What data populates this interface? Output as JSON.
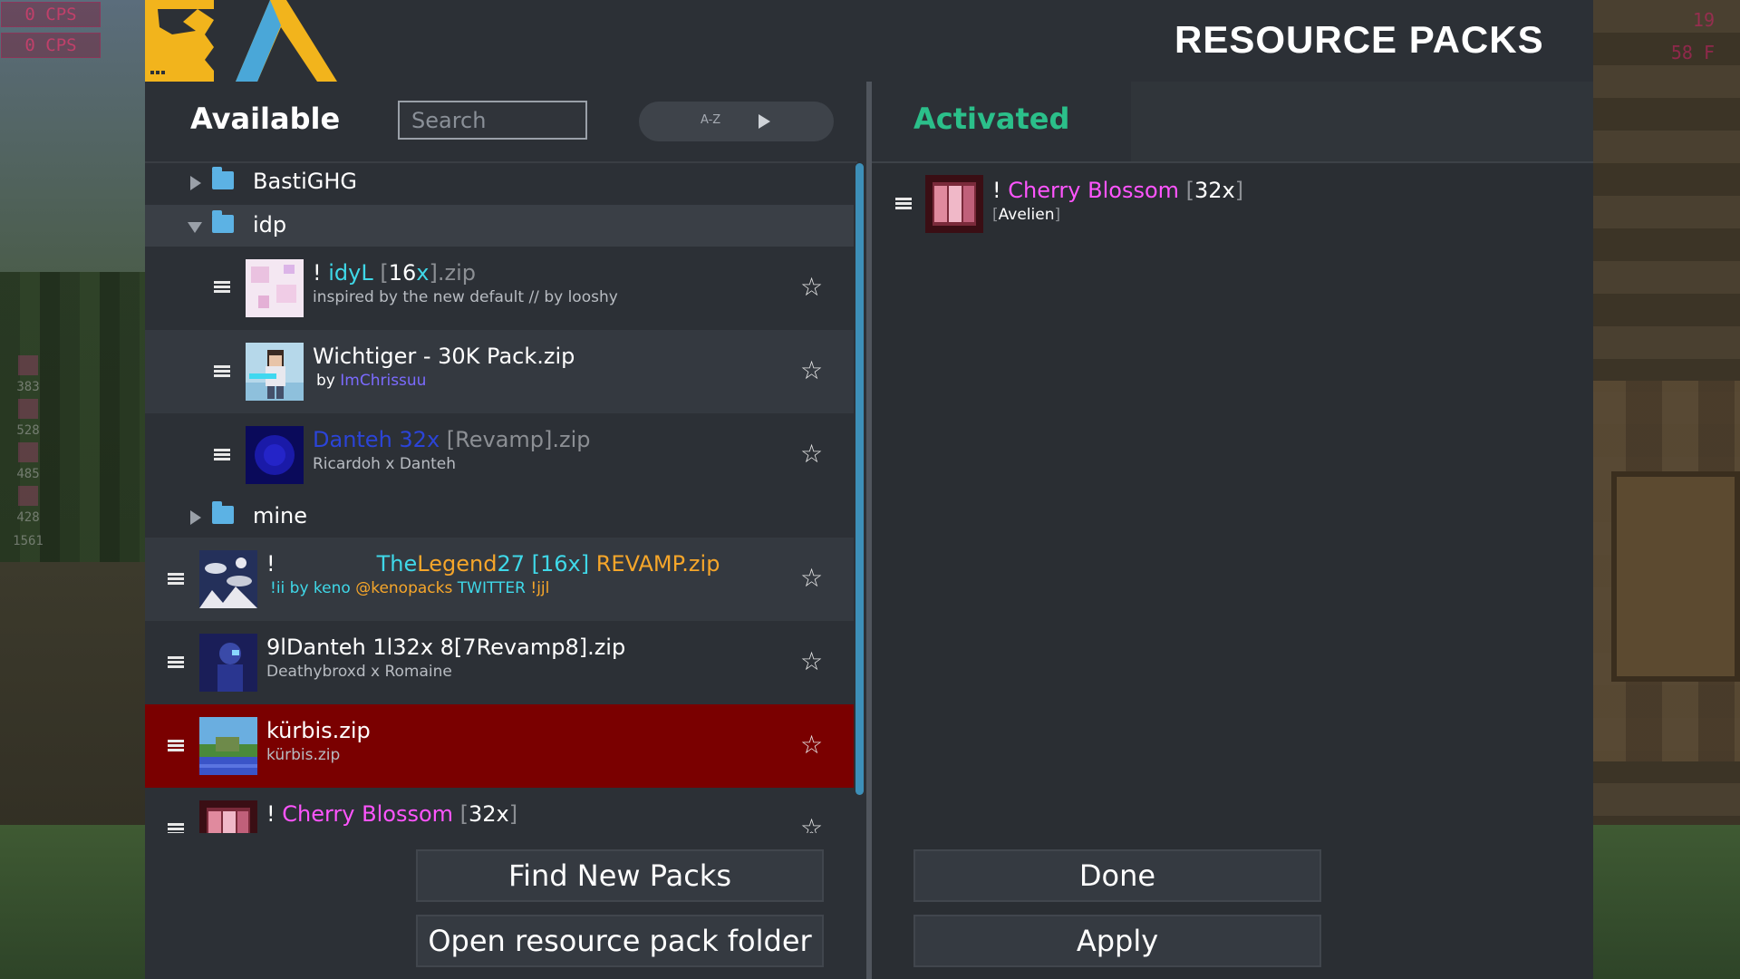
{
  "hud": {
    "cps_top": "0 CPS",
    "cps_bottom": "0 CPS",
    "right_top": "19",
    "right_fps": "58 F",
    "left_stats": [
      "383",
      "528",
      "485",
      "428",
      "1561"
    ]
  },
  "window": {
    "title": "RESOURCE PACKS"
  },
  "available": {
    "heading": "Available",
    "search_placeholder": "Search",
    "sort_label": "A-Z"
  },
  "activated": {
    "heading": "Activated",
    "packs": [
      {
        "prefix": "! ",
        "name": "Cherry Blossom",
        "bracket_open": " [",
        "res": "32x",
        "bracket_close": "]",
        "author_open": "[",
        "author": "Avelien",
        "author_close": "]"
      }
    ]
  },
  "folders": {
    "bastighg": "BastiGHG",
    "idp": "idp",
    "mine": "mine"
  },
  "packs": {
    "idyl": {
      "prefix": "! ",
      "name": "idyL",
      "open": " [",
      "res": "16",
      "x": "x",
      "close": "].zip",
      "desc": "inspired by the new default // by looshy"
    },
    "wichtiger": {
      "name": "Wichtiger - 30K Pack.zip",
      "by": "by ",
      "author": "ImChrissuu"
    },
    "danteh": {
      "name": "Danteh 32x",
      "rest": " [Revamp].zip",
      "desc": "Ricardoh x Danteh"
    },
    "legend": {
      "prefix": "!",
      "name_a": "The",
      "name_b": "Legend",
      "name_c": "27",
      "res": " [16x]",
      "rest": " REVAMP.zip",
      "sub_a": "!ii",
      "sub_b": "  by keno  ",
      "sub_c": "@kenopacks",
      "sub_d": "  TWITTER  ",
      "sub_e": " !jjl"
    },
    "danteh2": {
      "name": "9lDanteh 1l32x 8[7Revamp8].zip",
      "desc": "Deathybroxd x Romaine"
    },
    "kurbis": {
      "name": "kürbis.zip",
      "desc": "kürbis.zip"
    },
    "cherry": {
      "prefix": "! ",
      "name": "Cherry Blossom",
      "open": " [",
      "res": "32x",
      "close": "]"
    }
  },
  "buttons": {
    "find": "Find New Packs",
    "open_folder": "Open resource pack folder",
    "done": "Done",
    "apply": "Apply"
  },
  "colors": {
    "selected_row": "#7a0000",
    "activated_heading": "#2bbf8a",
    "scrollbar": "#3d8fb8",
    "folder": "#5cb2e4"
  },
  "icons": [
    "hamburger-icon",
    "star-icon",
    "folder-icon",
    "expand-arrow-icon",
    "sort-play-icon"
  ]
}
